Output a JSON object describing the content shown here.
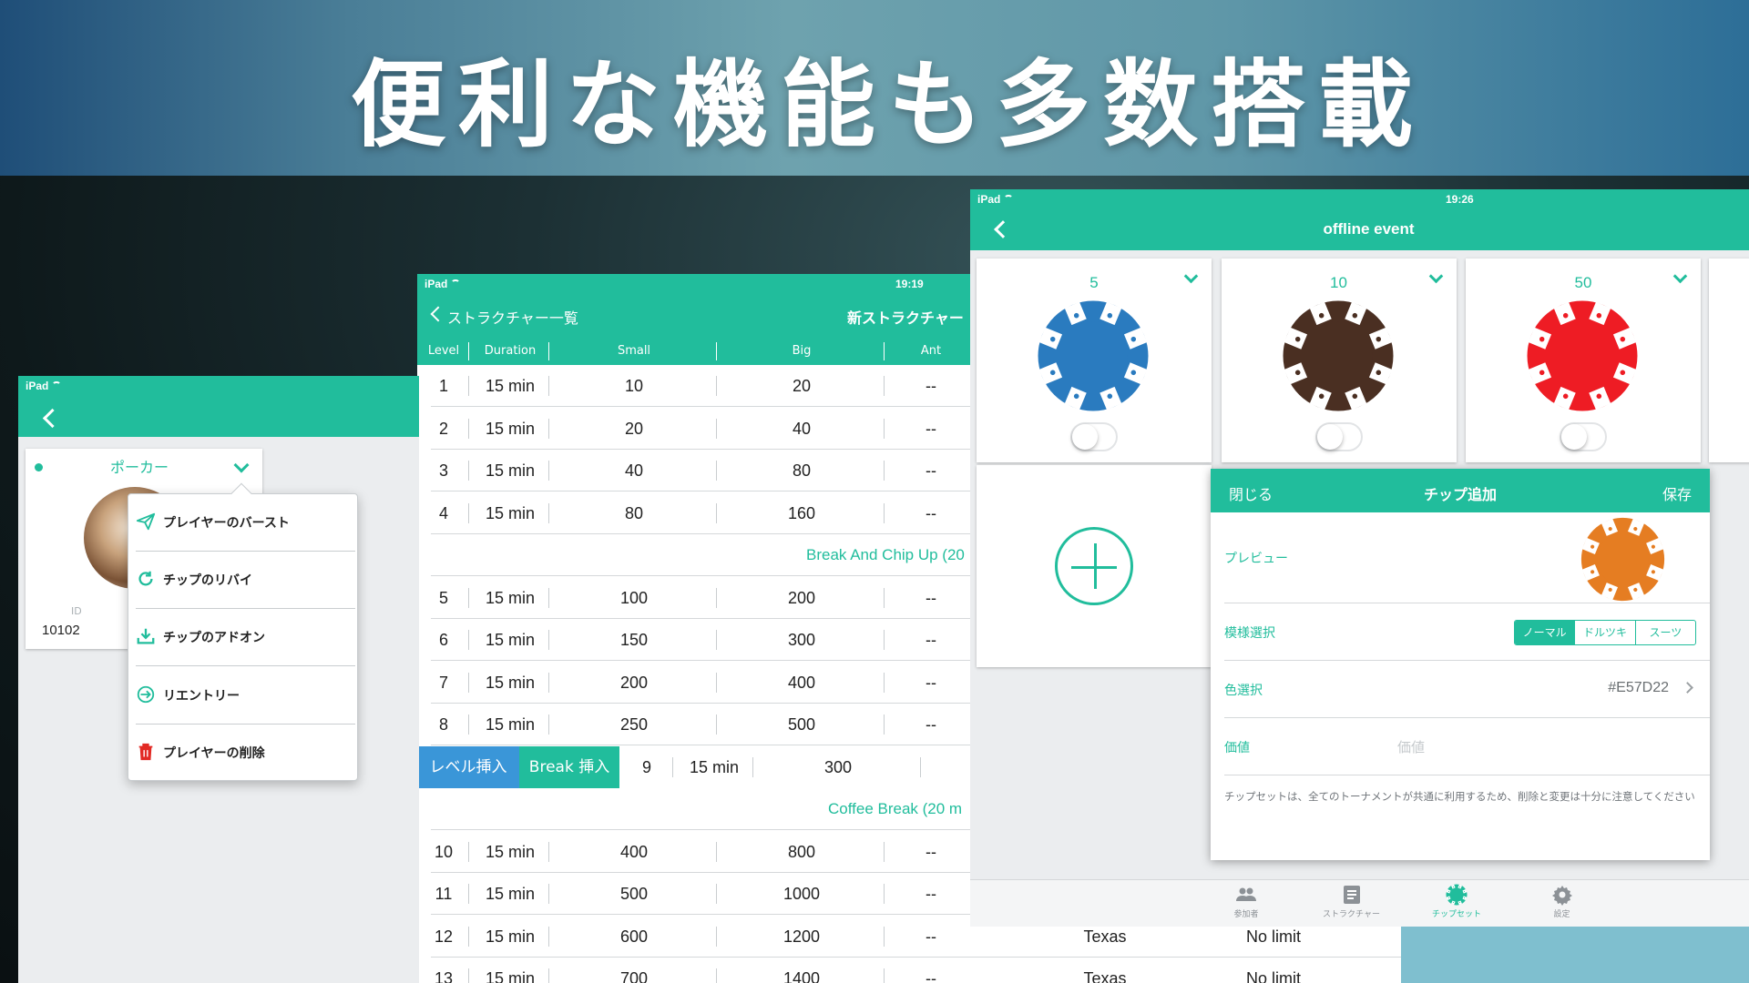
{
  "hero": {
    "title": "便利な機能も多数搭載"
  },
  "status": {
    "carrier": "iPad"
  },
  "screen1": {
    "card": {
      "name": "ポーカー",
      "id_label": "ID",
      "id_value": "10102"
    },
    "menu": [
      {
        "icon": "paper-plane-icon",
        "label": "プレイヤーのバースト"
      },
      {
        "icon": "refresh-icon",
        "label": "チップのリバイ"
      },
      {
        "icon": "download-icon",
        "label": "チップのアドオン"
      },
      {
        "icon": "reentry-icon",
        "label": "リエントリー"
      },
      {
        "icon": "trash-icon",
        "label": "プレイヤーの削除"
      }
    ]
  },
  "screen2": {
    "time": "19:19",
    "back_label": "ストラクチャー一覧",
    "title": "新ストラクチャー",
    "columns": [
      "Level",
      "Duration",
      "Small",
      "Big",
      "Ant"
    ],
    "rows": [
      {
        "type": "level",
        "level": "1",
        "duration": "15 min",
        "small": "10",
        "big": "20",
        "ante": "--"
      },
      {
        "type": "level",
        "level": "2",
        "duration": "15 min",
        "small": "20",
        "big": "40",
        "ante": "--"
      },
      {
        "type": "level",
        "level": "3",
        "duration": "15 min",
        "small": "40",
        "big": "80",
        "ante": "--"
      },
      {
        "type": "level",
        "level": "4",
        "duration": "15 min",
        "small": "80",
        "big": "160",
        "ante": "--"
      },
      {
        "type": "break",
        "label": "Break And Chip Up (20"
      },
      {
        "type": "level",
        "level": "5",
        "duration": "15 min",
        "small": "100",
        "big": "200",
        "ante": "--"
      },
      {
        "type": "level",
        "level": "6",
        "duration": "15 min",
        "small": "150",
        "big": "300",
        "ante": "--"
      },
      {
        "type": "level",
        "level": "7",
        "duration": "15 min",
        "small": "200",
        "big": "400",
        "ante": "--"
      },
      {
        "type": "level",
        "level": "8",
        "duration": "15 min",
        "small": "250",
        "big": "500",
        "ante": "--"
      },
      {
        "type": "insert",
        "insert_level_label": "レベル挿入",
        "insert_break_label": "Break 挿入",
        "level": "9",
        "duration": "15 min",
        "small": "300"
      },
      {
        "type": "break",
        "label": "Coffee Break (20 m"
      },
      {
        "type": "level",
        "level": "10",
        "duration": "15 min",
        "small": "400",
        "big": "800",
        "ante": "--"
      },
      {
        "type": "level",
        "level": "11",
        "duration": "15 min",
        "small": "500",
        "big": "1000",
        "ante": "--"
      },
      {
        "type": "level",
        "level": "12",
        "duration": "15 min",
        "small": "600",
        "big": "1200",
        "ante": "--",
        "game": "Texas",
        "limit": "No limit"
      },
      {
        "type": "level",
        "level": "13",
        "duration": "15 min",
        "small": "700",
        "big": "1400",
        "ante": "--",
        "game": "Texas",
        "limit": "No limit"
      }
    ]
  },
  "screen3": {
    "time": "19:26",
    "title": "offline event",
    "chips": [
      {
        "value": "5",
        "color": "#2a7bbf"
      },
      {
        "value": "10",
        "color": "#4a2f22"
      },
      {
        "value": "50",
        "color": "#ee1c24"
      }
    ],
    "modal": {
      "close_label": "閉じる",
      "title": "チップ追加",
      "save_label": "保存",
      "preview_label": "プレビュー",
      "preview_color": "#E57D22",
      "pattern_label": "模様選択",
      "patterns": [
        "ノーマル",
        "ドルツキ",
        "スーツ"
      ],
      "pattern_selected": "ノーマル",
      "color_label": "色選択",
      "color_value": "#E57D22",
      "value_label": "価値",
      "value_placeholder": "価値",
      "note": "チップセットは、全てのトーナメントが共通に利用するため、削除と変更は十分に注意してください"
    },
    "tabs": [
      {
        "icon": "people-icon",
        "label": "参加者",
        "active": false
      },
      {
        "icon": "list-icon",
        "label": "ストラクチャー",
        "active": false
      },
      {
        "icon": "chip-icon",
        "label": "チップセット",
        "active": true
      },
      {
        "icon": "gear-icon",
        "label": "設定",
        "active": false
      }
    ]
  },
  "colors": {
    "accent": "#21bd9c",
    "break_button": "#3a96d8"
  }
}
